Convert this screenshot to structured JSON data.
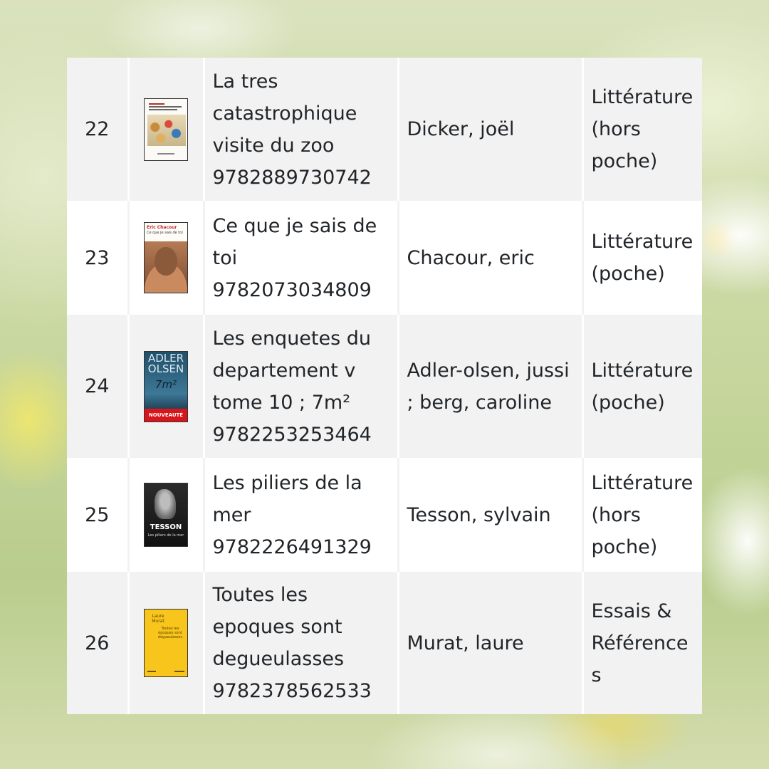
{
  "rows": [
    {
      "rank": "22",
      "cover_icon": "book-cover-zoo",
      "title_lines": [
        "La tres",
        "catastrophique",
        "visite du zoo",
        "9782889730742"
      ],
      "author": "Dicker, joël",
      "category_lines": [
        "Littérature",
        "(hors",
        "poche)"
      ]
    },
    {
      "rank": "23",
      "cover_icon": "book-cover-chacour",
      "title_lines": [
        "Ce que je sais de",
        "toi",
        "9782073034809"
      ],
      "author": "Chacour, eric",
      "category_lines": [
        "Littérature",
        "(poche)"
      ]
    },
    {
      "rank": "24",
      "cover_icon": "book-cover-adler-olsen",
      "title_lines": [
        "Les enquetes du",
        "departement v",
        "tome 10 ; 7m²",
        "9782253253464"
      ],
      "author_lines": [
        "Adler-olsen, jussi",
        "; berg, caroline"
      ],
      "category_lines": [
        "Littérature",
        "(poche)"
      ]
    },
    {
      "rank": "25",
      "cover_icon": "book-cover-tesson",
      "title_lines": [
        "Les piliers de la",
        "mer",
        "9782226491329"
      ],
      "author": "Tesson, sylvain",
      "category_lines": [
        "Littérature",
        "(hors",
        "poche)"
      ]
    },
    {
      "rank": "26",
      "cover_icon": "book-cover-murat",
      "title_lines": [
        "Toutes les",
        "epoques sont",
        "degueulasses",
        "9782378562533"
      ],
      "author": "Murat, laure",
      "category_lines": [
        "Essais &",
        "Références"
      ]
    }
  ],
  "cover_text": {
    "chacour_author": "Eric Chacour",
    "chacour_title": "Ce que je sais de toi",
    "adler_name1": "ADLER",
    "adler_name2": "OLSEN",
    "adler_mark": "7m²",
    "adler_badge": "NOUVEAUTÉ",
    "tesson_name": "TESSON",
    "tesson_title": "Les piliers de la mer",
    "murat_author": "Laure Murat",
    "murat_title": "Toutes les époques sont dégueulasses"
  },
  "colors": {
    "row_odd": "#f2f2f2",
    "row_even": "#ffffff",
    "text": "#212529",
    "adler_blue": "#2c5f7c",
    "adler_red": "#d8151b",
    "murat_yellow": "#f7c51c"
  }
}
